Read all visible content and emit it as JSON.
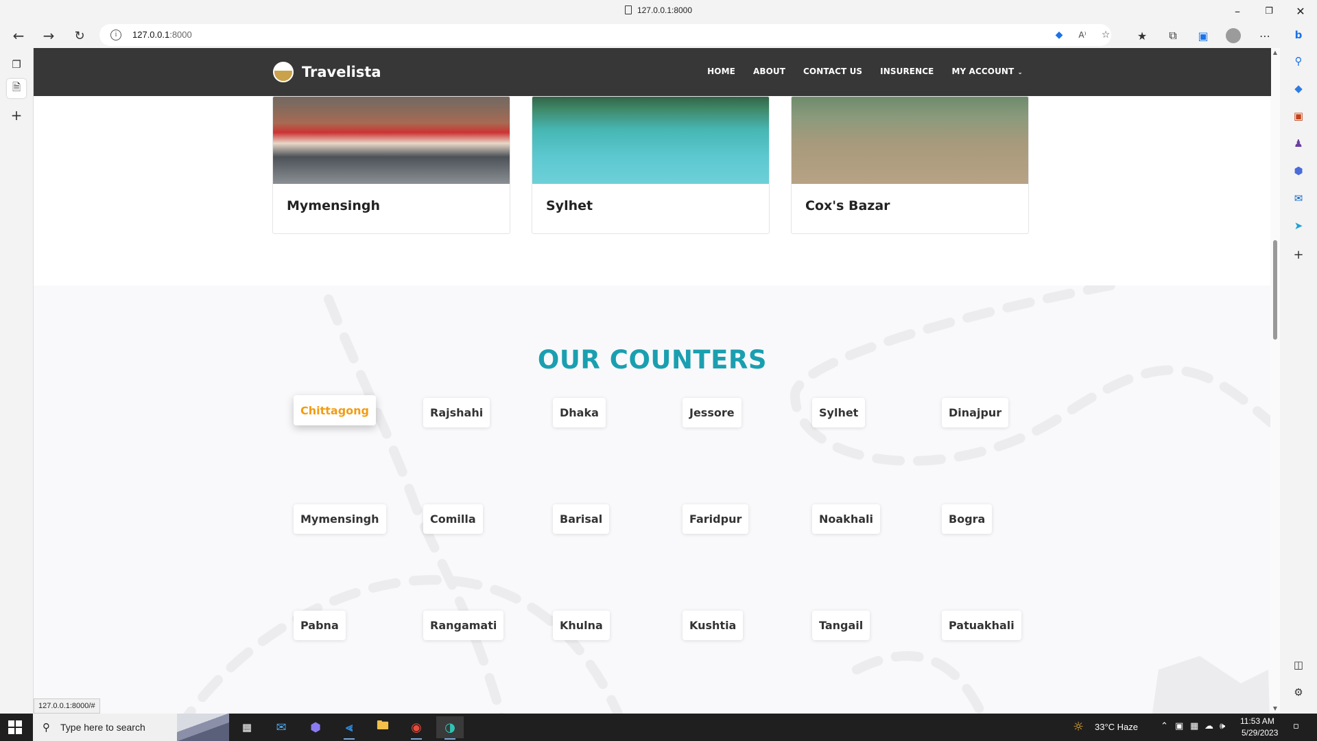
{
  "browser": {
    "tab_title": "127.0.0.1:8000",
    "url_host": "127.0.0.1",
    "url_port": ":8000",
    "status_url": "127.0.0.1:8000/#"
  },
  "site": {
    "brand": "Travelista",
    "nav": [
      "HOME",
      "ABOUT",
      "CONTACT US",
      "INSURENCE",
      "MY ACCOUNT"
    ],
    "destinations": [
      "Mymensingh",
      "Sylhet",
      "Cox's Bazar"
    ],
    "counters_title": "OUR COUNTERS",
    "counters": [
      [
        "Chittagong",
        "Rajshahi",
        "Dhaka",
        "Jessore",
        "Sylhet",
        "Dinajpur"
      ],
      [
        "Mymensingh",
        "Comilla",
        "Barisal",
        "Faridpur",
        "Noakhali",
        "Bogra"
      ],
      [
        "Pabna",
        "Rangamati",
        "Khulna",
        "Kushtia",
        "Tangail",
        "Patuakhali"
      ]
    ],
    "active_counter": "Chittagong",
    "colors": {
      "accent_teal": "#1a9fb0",
      "active_orange": "#f39c12",
      "header_dark": "#161616"
    }
  },
  "taskbar": {
    "search_placeholder": "Type here to search",
    "weather": "33°C  Haze",
    "time": "11:53 AM",
    "date": "5/29/2023"
  }
}
